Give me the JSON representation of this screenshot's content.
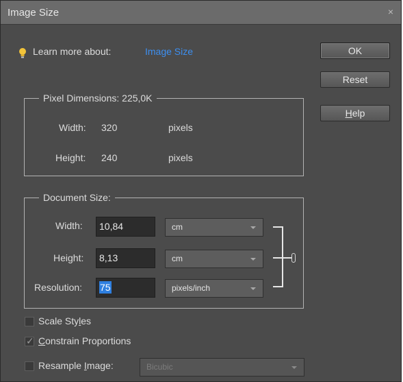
{
  "window": {
    "title": "Image Size",
    "close_glyph": "×"
  },
  "learn_more": {
    "prefix": "Learn more about:",
    "link": "Image Size",
    "icon": "lightbulb-icon",
    "link_color": "#3d8ff0"
  },
  "buttons": {
    "ok": "OK",
    "reset": "Reset",
    "help_mnemonic": "H",
    "help_rest": "elp"
  },
  "pixel_dimensions": {
    "legend": "Pixel Dimensions:  225,0K",
    "width_label": "Width:",
    "width_value": "320",
    "width_unit": "pixels",
    "height_label": "Height:",
    "height_value": "240",
    "height_unit": "pixels"
  },
  "document_size": {
    "legend": "Document Size:",
    "width_label": "Width:",
    "width_value": "10,84",
    "width_unit": "cm",
    "height_label": "Height:",
    "height_value": "8,13",
    "height_unit": "cm",
    "resolution_label": "Resolution:",
    "resolution_value": "75",
    "resolution_unit": "pixels/inch"
  },
  "options": {
    "scale_styles_pre": "Scale Sty",
    "scale_styles_mnemonic": "l",
    "scale_styles_post": "es",
    "scale_styles_checked": false,
    "constrain_mnemonic": "C",
    "constrain_post": "onstrain Proportions",
    "constrain_checked": true,
    "resample_pre": "Resample ",
    "resample_mnemonic": "I",
    "resample_post": "mage:",
    "resample_checked": false,
    "resample_method": "Bicubic",
    "check_glyph": "✓"
  }
}
